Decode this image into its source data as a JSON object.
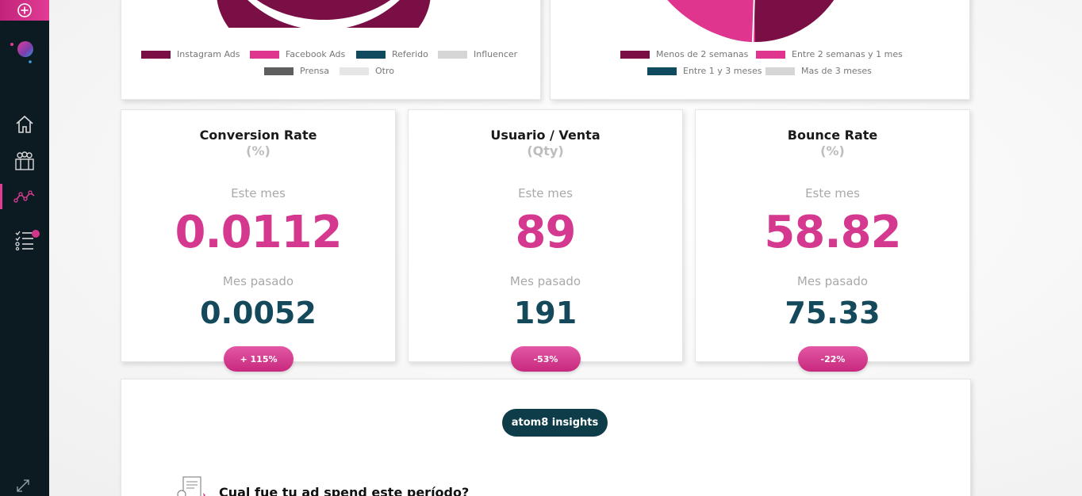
{
  "sidebar": {
    "icons": [
      "add-icon",
      "logo",
      "home-icon",
      "team-icon",
      "analytics-icon",
      "checklist-icon",
      "expand-icon"
    ],
    "accent": "#e23c95",
    "background": "#0c1a22"
  },
  "source_chart": {
    "legend": [
      {
        "label": "Instagram Ads",
        "color": "#7a0f45"
      },
      {
        "label": "Facebook Ads",
        "color": "#e0358f"
      },
      {
        "label": "Referido",
        "color": "#0f4a5e"
      },
      {
        "label": "Influencer",
        "color": "#d6d6d6"
      },
      {
        "label": "Prensa",
        "color": "#5e5e5e"
      },
      {
        "label": "Otro",
        "color": "#e6e6e6"
      }
    ]
  },
  "time_chart": {
    "legend": [
      {
        "label": "Menos de 2 semanas",
        "color": "#7a0f45"
      },
      {
        "label": "Entre 2 semanas y 1 mes",
        "color": "#e0358f"
      },
      {
        "label": "Entre 1 y 3 meses",
        "color": "#0f4a5e"
      },
      {
        "label": "Mas de 3 meses",
        "color": "#d6d6d6"
      }
    ]
  },
  "metrics": [
    {
      "title": "Conversion Rate",
      "unit": "(%)",
      "current_label": "Este mes",
      "current_value": "0.0112",
      "previous_label": "Mes pasado",
      "previous_value": "0.0052",
      "change": "+ 115%"
    },
    {
      "title": "Usuario / Venta",
      "unit": "(Qty)",
      "current_label": "Este mes",
      "current_value": "89",
      "previous_label": "Mes pasado",
      "previous_value": "191",
      "change": "-53%"
    },
    {
      "title": "Bounce Rate",
      "unit": "(%)",
      "current_label": "Este mes",
      "current_value": "58.82",
      "previous_label": "Mes pasado",
      "previous_value": "75.33",
      "change": "-22%"
    }
  ],
  "insights": {
    "button_label": "atom8 insights",
    "question": "Cual fue tu ad spend este período?",
    "question_icon": "document-icon"
  },
  "colors": {
    "current_value": "#d4398f",
    "previous_value": "#14495c",
    "insights_button": "#0e3d49"
  }
}
